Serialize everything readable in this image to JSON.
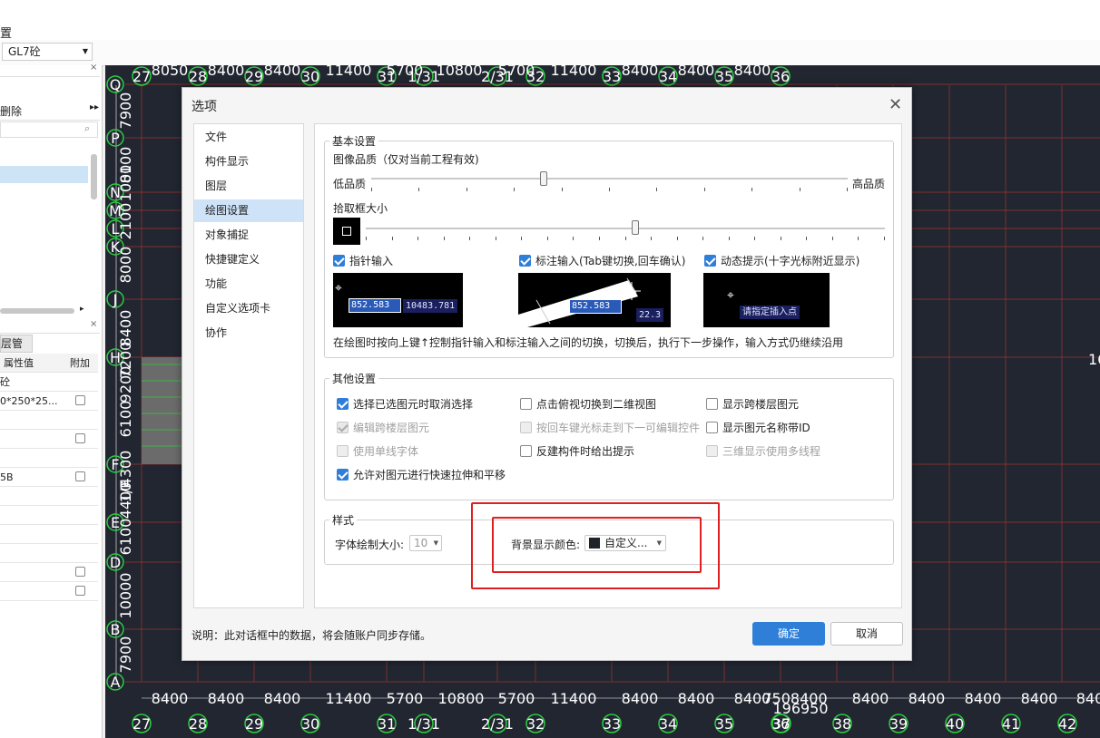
{
  "app": {
    "menu_fragment": "置",
    "floor_select": "GL7砼",
    "left_panel": {
      "delete_label": "删除",
      "layer_tab": "层管理",
      "columns": [
        "属性值",
        "附加"
      ],
      "rows": [
        "砼",
        "0*250*25...",
        "",
        "",
        "",
        "5B",
        "",
        "",
        "",
        "",
        "",
        ""
      ]
    }
  },
  "canvas": {
    "top_axes": [
      "27",
      "28",
      "29",
      "30",
      "31",
      "1/31",
      "2/31",
      "32",
      "33",
      "34",
      "35",
      "36"
    ],
    "top_dims": [
      "8050",
      "8400",
      "8400",
      "11400",
      "5700",
      "10800",
      "5700",
      "11400",
      "8400",
      "8400",
      "8400"
    ],
    "bottom_axes": [
      "27",
      "28",
      "29",
      "30",
      "31",
      "1/31",
      "2/31",
      "32",
      "33",
      "34",
      "35",
      "36",
      "37",
      "38",
      "39",
      "40",
      "41",
      "42"
    ],
    "bottom_dims": [
      "8400",
      "8400",
      "8400",
      "11400",
      "5700",
      "10800",
      "5700",
      "11400",
      "8400",
      "8400",
      "8400",
      "7508400",
      "8400",
      "8400",
      "8400",
      "8400",
      "840"
    ],
    "bottom_total": "196950",
    "left_axes": [
      "Q",
      "P",
      "N",
      "M",
      "L",
      "K",
      "J",
      "H",
      "F",
      "E",
      "D",
      "B",
      "A"
    ],
    "left_dims": [
      "7900",
      "8100",
      "1000",
      "2100",
      "8000",
      "8400",
      "7200",
      "9200",
      "6100",
      "4300",
      "4400",
      "6100",
      "10000",
      "7900",
      "1/F"
    ],
    "right_fragment": "16"
  },
  "dialog": {
    "title": "选项",
    "nav": [
      "文件",
      "构件显示",
      "图层",
      "绘图设置",
      "对象捕捉",
      "快捷键定义",
      "功能",
      "自定义选项卡",
      "协作"
    ],
    "nav_selected": 3,
    "basic": {
      "title": "基本设置",
      "quality_label": "图像品质（仅对当前工程有效)",
      "low": "低品质",
      "high": "高品质",
      "quality_level": 0.36,
      "pick_label": "拾取框大小",
      "pick_level": 0.52,
      "pointer_input": "指针输入",
      "dim_input": "标注输入(Tab键切换,回车确认)",
      "dynamic_hint": "动态提示(十字光标附近显示)",
      "pv1_val1": "852.583",
      "pv1_val2": "10483.781",
      "pv2_val1": "852.583",
      "pv2_val2": "22.3",
      "pv3_text": "请指定插入点",
      "note": "在绘图时按向上键↑控制指针输入和标注输入之间的切换，切换后，执行下一步操作，输入方式仍继续沿用"
    },
    "other": {
      "title": "其他设置",
      "items": [
        {
          "label": "选择已选图元时取消选择",
          "checked": true,
          "disabled": false
        },
        {
          "label": "点击俯视切换到二维视图",
          "checked": false,
          "disabled": false
        },
        {
          "label": "显示跨楼层图元",
          "checked": false,
          "disabled": false
        },
        {
          "label": "编辑跨楼层图元",
          "checked": true,
          "disabled": true
        },
        {
          "label": "按回车键光标走到下一可编辑控件",
          "checked": false,
          "disabled": true
        },
        {
          "label": "显示图元名称带ID",
          "checked": false,
          "disabled": false
        },
        {
          "label": "使用单线字体",
          "checked": false,
          "disabled": true
        },
        {
          "label": "反建构件时给出提示",
          "checked": false,
          "disabled": false
        },
        {
          "label": "三维显示使用多线程",
          "checked": false,
          "disabled": true
        },
        {
          "label": "允许对图元进行快速拉伸和平移",
          "checked": true,
          "disabled": false
        }
      ]
    },
    "style": {
      "title": "样式",
      "font_size_label": "字体绘制大小:",
      "font_size_value": "10",
      "bg_color_label": "背景显示颜色:",
      "bg_color_value": "自定义...",
      "bg_color_swatch": "#1f2229"
    },
    "footer_note": "说明：此对话框中的数据，将会随账户同步存储。",
    "ok": "确定",
    "cancel": "取消",
    "colors": {
      "accent": "#2f7fd8",
      "highlight": "#e02020",
      "canvas_bg": "#212631",
      "grid_line": "#c0392b",
      "axis_circle": "#2ecc40"
    }
  }
}
